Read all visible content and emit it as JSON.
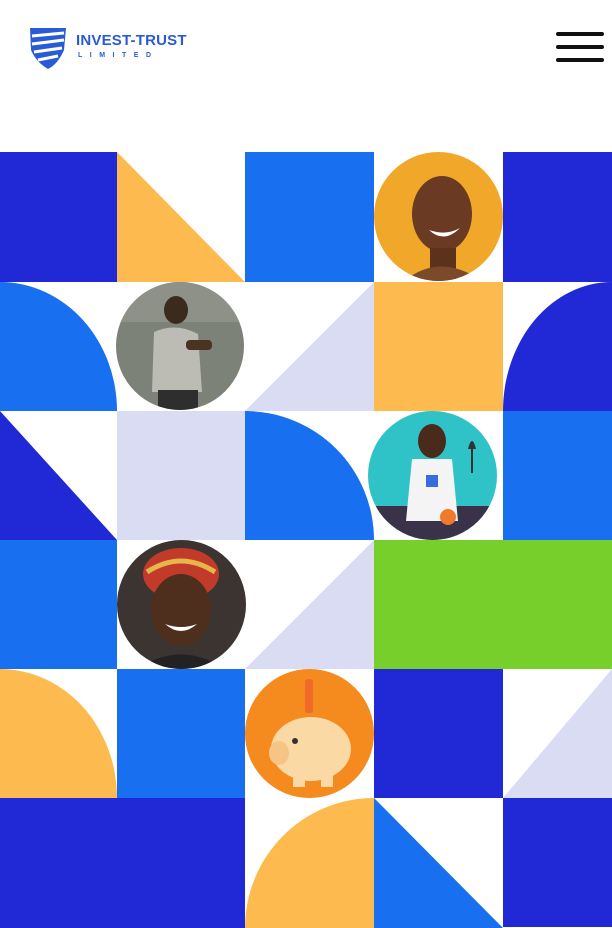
{
  "header": {
    "brand_name": "INVEST-TRUST",
    "brand_sub": "LIMITED",
    "menu_icon": "hamburger-menu-icon"
  },
  "colors": {
    "royal_blue": "#2129d6",
    "bright_blue": "#1870f0",
    "yellow": "#fdbb4f",
    "lavender": "#dadcf4",
    "green": "#76cf2b",
    "white": "#ffffff"
  },
  "gallery": {
    "photos": [
      {
        "alt": "smiling woman with shaved head on orange background"
      },
      {
        "alt": "young man in grey t-shirt looking at phone"
      },
      {
        "alt": "woman in apron holding whisk on teal background"
      },
      {
        "alt": "smiling woman wearing patterned headwrap"
      },
      {
        "alt": "piggy bank with coin on orange background"
      }
    ]
  }
}
